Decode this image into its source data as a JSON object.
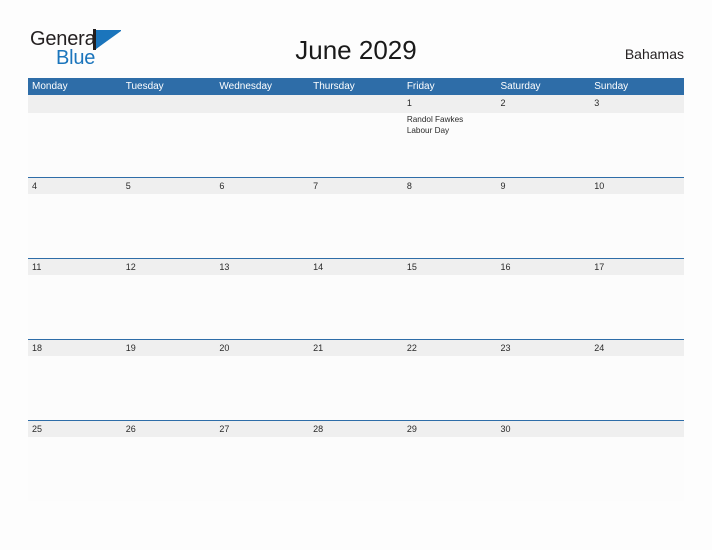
{
  "brand": {
    "name_part1": "General",
    "name_part2": "Blue",
    "flag_color": "#1B75BC",
    "text_color": "#231F20"
  },
  "header": {
    "title": "June 2029",
    "country": "Bahamas"
  },
  "theme": {
    "header_blue": "#2E6DA8",
    "date_band_gray": "#EFEFEF",
    "cell_white": "#FCFCFC",
    "page_background": "#FDFDFD",
    "text_dark": "#2A2A2A"
  },
  "calendar": {
    "weekdays": [
      "Monday",
      "Tuesday",
      "Wednesday",
      "Thursday",
      "Friday",
      "Saturday",
      "Sunday"
    ],
    "weeks": [
      {
        "days": [
          {
            "date": "",
            "events": []
          },
          {
            "date": "",
            "events": []
          },
          {
            "date": "",
            "events": []
          },
          {
            "date": "",
            "events": []
          },
          {
            "date": "1",
            "events": [
              "Randol Fawkes",
              "Labour Day"
            ]
          },
          {
            "date": "2",
            "events": []
          },
          {
            "date": "3",
            "events": []
          }
        ]
      },
      {
        "days": [
          {
            "date": "4",
            "events": []
          },
          {
            "date": "5",
            "events": []
          },
          {
            "date": "6",
            "events": []
          },
          {
            "date": "7",
            "events": []
          },
          {
            "date": "8",
            "events": []
          },
          {
            "date": "9",
            "events": []
          },
          {
            "date": "10",
            "events": []
          }
        ]
      },
      {
        "days": [
          {
            "date": "11",
            "events": []
          },
          {
            "date": "12",
            "events": []
          },
          {
            "date": "13",
            "events": []
          },
          {
            "date": "14",
            "events": []
          },
          {
            "date": "15",
            "events": []
          },
          {
            "date": "16",
            "events": []
          },
          {
            "date": "17",
            "events": []
          }
        ]
      },
      {
        "days": [
          {
            "date": "18",
            "events": []
          },
          {
            "date": "19",
            "events": []
          },
          {
            "date": "20",
            "events": []
          },
          {
            "date": "21",
            "events": []
          },
          {
            "date": "22",
            "events": []
          },
          {
            "date": "23",
            "events": []
          },
          {
            "date": "24",
            "events": []
          }
        ]
      },
      {
        "days": [
          {
            "date": "25",
            "events": []
          },
          {
            "date": "26",
            "events": []
          },
          {
            "date": "27",
            "events": []
          },
          {
            "date": "28",
            "events": []
          },
          {
            "date": "29",
            "events": []
          },
          {
            "date": "30",
            "events": []
          },
          {
            "date": "",
            "events": []
          }
        ]
      }
    ]
  }
}
